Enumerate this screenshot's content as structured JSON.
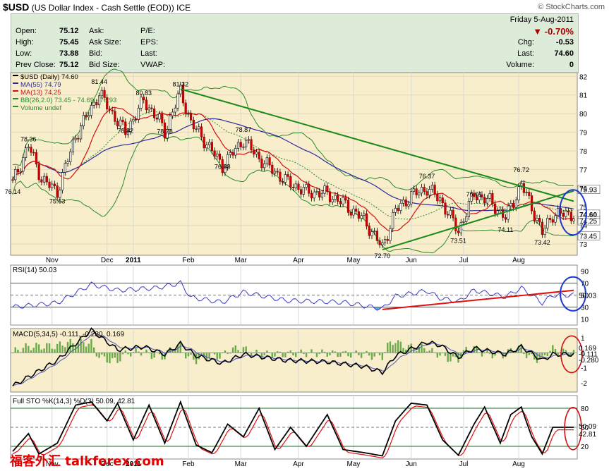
{
  "header": {
    "symbol": "$USD",
    "description": "(US Dollar Index - Cash Settle (EOD))",
    "exchange": "ICE",
    "brand": "© StockCharts.com"
  },
  "quote": {
    "date": "Friday  5-Aug-2011",
    "pct_change": "-0.70%",
    "chg_label": "Chg:",
    "chg": "-0.53",
    "last_label": "Last:",
    "last": "74.60",
    "volume_label": "Volume:",
    "volume": "0",
    "rows": [
      {
        "label": "Open:",
        "value": "75.12",
        "mid": "Ask:",
        "right": "P/E:"
      },
      {
        "label": "High:",
        "value": "75.45",
        "mid": "Ask Size:",
        "right": "EPS:"
      },
      {
        "label": "Low:",
        "value": "73.88",
        "mid": "Bid:",
        "right": "Last:"
      },
      {
        "label": "Prev Close:",
        "value": "75.12",
        "mid": "Bid Size:",
        "right": "VWAP:"
      }
    ],
    "down_color": "#b00000"
  },
  "legend": [
    {
      "text": "$USD (Daily) 74.60",
      "color": "#000000",
      "icon": "candle-icon"
    },
    {
      "text": "MA(55) 74.79",
      "color": "#2a2a9a",
      "icon": "line-icon"
    },
    {
      "text": "MA(13) 74.25",
      "color": "#d41010",
      "icon": "line-icon"
    },
    {
      "text": "BB(26,2.0) 73.45 - 74.69 - 75.93",
      "color": "#2a8a2a",
      "icon": "line-icon"
    },
    {
      "text": "Volume undef",
      "color": "#2a8a2a",
      "icon": "line-icon"
    }
  ],
  "chart_data": {
    "type": "line",
    "x_labels": [
      "Nov",
      "Dec",
      "2011",
      "Feb",
      "Mar",
      "Apr",
      "May",
      "Jun",
      "Jul",
      "Aug"
    ],
    "price": {
      "ylim": [
        72.4,
        82.2
      ],
      "yticks": [
        73,
        74,
        75,
        76,
        77,
        78,
        79,
        80,
        81,
        82
      ],
      "annotations": [
        {
          "day": 0,
          "value": 76.14,
          "text": "76.14"
        },
        {
          "day": 6,
          "value": 78.36,
          "text": "78.36"
        },
        {
          "day": 17,
          "value": 75.63,
          "text": "75.63"
        },
        {
          "day": 33,
          "value": 81.44,
          "text": "81.44"
        },
        {
          "day": 43,
          "value": 78.82,
          "text": "78.82"
        },
        {
          "day": 50,
          "value": 80.83,
          "text": "80.83"
        },
        {
          "day": 58,
          "value": 78.78,
          "text": "78.78"
        },
        {
          "day": 64,
          "value": 81.32,
          "text": "81.32"
        },
        {
          "day": 80,
          "value": 76.88,
          "text": "76.88"
        },
        {
          "day": 88,
          "value": 78.87,
          "text": "78.87"
        },
        {
          "day": 141,
          "value": 72.7,
          "text": "72.70"
        },
        {
          "day": 158,
          "value": 76.37,
          "text": "76.37"
        },
        {
          "day": 170,
          "value": 73.51,
          "text": "73.51"
        },
        {
          "day": 176,
          "value": 76.01,
          "text": "76.01"
        },
        {
          "day": 188,
          "value": 74.11,
          "text": "74.11"
        },
        {
          "day": 194,
          "value": 76.72,
          "text": "76.72"
        },
        {
          "day": 202,
          "value": 73.42,
          "text": "73.42"
        }
      ],
      "last_labels": [
        {
          "value": 75.93,
          "text": "75.93"
        },
        {
          "value": 74.6,
          "text": "74.60"
        },
        {
          "value": 74.25,
          "text": "74.25"
        },
        {
          "value": 73.45,
          "text": "73.45"
        }
      ],
      "anchors": [
        [
          0,
          76.3
        ],
        [
          6,
          78.3
        ],
        [
          11,
          76.5
        ],
        [
          17,
          75.8
        ],
        [
          24,
          78.8
        ],
        [
          30,
          80.3
        ],
        [
          33,
          81.1
        ],
        [
          38,
          80.0
        ],
        [
          43,
          79.0
        ],
        [
          50,
          80.7
        ],
        [
          56,
          79.6
        ],
        [
          58,
          79.0
        ],
        [
          64,
          81.2
        ],
        [
          68,
          79.5
        ],
        [
          74,
          78.4
        ],
        [
          80,
          77.2
        ],
        [
          88,
          78.6
        ],
        [
          94,
          77.6
        ],
        [
          104,
          76.4
        ],
        [
          112,
          75.8
        ],
        [
          120,
          75.7
        ],
        [
          126,
          75.2
        ],
        [
          134,
          74.3
        ],
        [
          141,
          72.8
        ],
        [
          146,
          74.8
        ],
        [
          152,
          75.6
        ],
        [
          158,
          76.0
        ],
        [
          163,
          75.4
        ],
        [
          170,
          73.7
        ],
        [
          176,
          75.7
        ],
        [
          182,
          75.3
        ],
        [
          188,
          74.4
        ],
        [
          194,
          76.2
        ],
        [
          198,
          75.0
        ],
        [
          202,
          73.6
        ],
        [
          206,
          74.6
        ]
      ],
      "trendlines": [
        {
          "from": [
            64,
            81.32
          ],
          "to": [
            214,
            75.3
          ]
        },
        {
          "from": [
            141,
            72.7
          ],
          "to": [
            214,
            75.85
          ]
        }
      ]
    },
    "rsi": {
      "label": "RSI(14) 50.03",
      "ylim": [
        0,
        100
      ],
      "yticks": [
        10,
        30,
        50,
        70,
        90
      ],
      "last": "50.03",
      "anchors": [
        [
          0,
          30
        ],
        [
          17,
          37
        ],
        [
          30,
          68
        ],
        [
          40,
          58
        ],
        [
          55,
          62
        ],
        [
          64,
          70
        ],
        [
          68,
          46
        ],
        [
          80,
          38
        ],
        [
          88,
          55
        ],
        [
          104,
          41
        ],
        [
          126,
          38
        ],
        [
          141,
          27
        ],
        [
          146,
          48
        ],
        [
          158,
          57
        ],
        [
          163,
          45
        ],
        [
          170,
          39
        ],
        [
          176,
          58
        ],
        [
          188,
          47
        ],
        [
          194,
          62
        ],
        [
          202,
          37
        ],
        [
          206,
          50
        ]
      ],
      "trendline": {
        "from": [
          141,
          26
        ],
        "to": [
          214,
          58
        ]
      }
    },
    "macd": {
      "label": "MACD(5,34,5) -0.111, -0.280, 0.169",
      "ylim": [
        -2.6,
        1.6
      ],
      "yticks": [
        -2,
        -1,
        0,
        1
      ],
      "last_labels": [
        "0.169",
        "-0.111",
        "-0.280"
      ],
      "anchors": [
        [
          0,
          -2.2
        ],
        [
          6,
          -1.6
        ],
        [
          17,
          -0.5
        ],
        [
          24,
          0.6
        ],
        [
          30,
          1.5
        ],
        [
          40,
          0.2
        ],
        [
          50,
          0.4
        ],
        [
          58,
          -0.1
        ],
        [
          64,
          0.6
        ],
        [
          70,
          -0.2
        ],
        [
          80,
          -0.7
        ],
        [
          88,
          -0.1
        ],
        [
          104,
          -0.5
        ],
        [
          120,
          -0.6
        ],
        [
          134,
          -0.9
        ],
        [
          141,
          -1.3
        ],
        [
          146,
          -0.2
        ],
        [
          158,
          0.7
        ],
        [
          163,
          0.5
        ],
        [
          170,
          -0.3
        ],
        [
          176,
          0.3
        ],
        [
          188,
          -0.1
        ],
        [
          194,
          0.4
        ],
        [
          202,
          -0.5
        ],
        [
          206,
          -0.11
        ]
      ]
    },
    "sto": {
      "label": "Full STO %K(14,3) %D(3) 50.09, 42.81",
      "ylim": [
        0,
        100
      ],
      "yticks": [
        20,
        50,
        80
      ],
      "last_labels": [
        "50.09",
        "42.81"
      ],
      "anchors": [
        [
          0,
          12
        ],
        [
          6,
          40
        ],
        [
          10,
          8
        ],
        [
          17,
          25
        ],
        [
          24,
          85
        ],
        [
          30,
          90
        ],
        [
          36,
          60
        ],
        [
          40,
          88
        ],
        [
          46,
          30
        ],
        [
          52,
          85
        ],
        [
          58,
          25
        ],
        [
          64,
          90
        ],
        [
          70,
          22
        ],
        [
          76,
          10
        ],
        [
          82,
          55
        ],
        [
          88,
          35
        ],
        [
          94,
          80
        ],
        [
          100,
          15
        ],
        [
          106,
          50
        ],
        [
          112,
          20
        ],
        [
          120,
          70
        ],
        [
          126,
          15
        ],
        [
          134,
          10
        ],
        [
          141,
          5
        ],
        [
          146,
          60
        ],
        [
          152,
          88
        ],
        [
          158,
          85
        ],
        [
          164,
          30
        ],
        [
          170,
          6
        ],
        [
          176,
          55
        ],
        [
          180,
          82
        ],
        [
          186,
          25
        ],
        [
          190,
          70
        ],
        [
          194,
          82
        ],
        [
          198,
          35
        ],
        [
          202,
          8
        ],
        [
          206,
          50
        ]
      ]
    }
  },
  "watermark": "福客外汇 talkforex.com"
}
